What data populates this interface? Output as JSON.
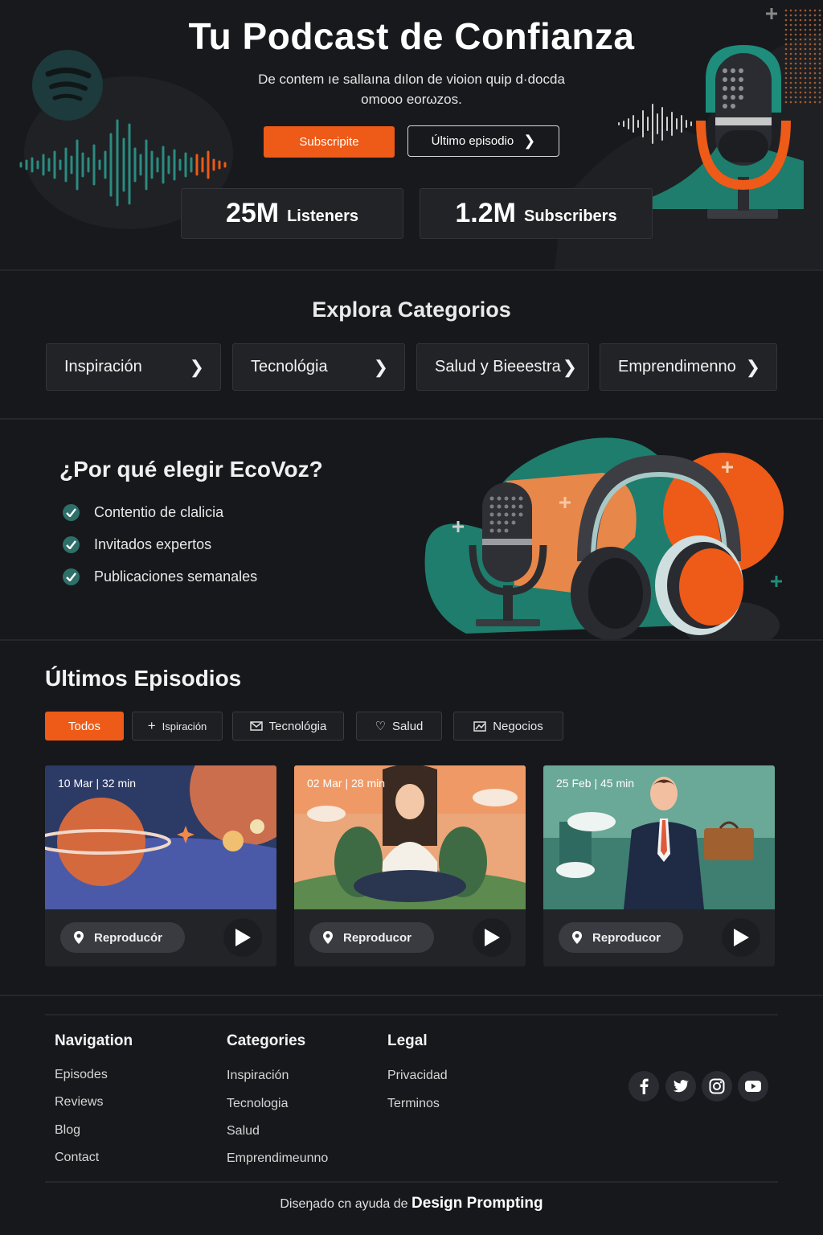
{
  "hero": {
    "title": "Tu Podcast de Confianza",
    "subtitle": "De contem ıe ѕаllаına dılon de vioion quip d·docda οmοοο eοrωzοs.",
    "subscribe_label": "Subscripite",
    "latest_label": "Último episodio",
    "stats": [
      {
        "value": "25M",
        "label": "Listeners"
      },
      {
        "value": "1.2M",
        "label": "Subscribers"
      }
    ]
  },
  "categories": {
    "title": "Explora Categorios",
    "items": [
      "Inspiración",
      "Tecnológia",
      "Salud y Bieeestra",
      "Emprendimenno"
    ]
  },
  "why": {
    "title": "¿Por qué elegir EcoVoz?",
    "items": [
      "Contentio de clalicia",
      "Invitados expertos",
      "Publicaciones semanales"
    ]
  },
  "episodes": {
    "title": "Últimos Episodios",
    "filters": [
      "Todos",
      "Ispiración",
      "Tecnológia",
      "Salud",
      "Negocios"
    ],
    "cards": [
      {
        "date": "10 Mar | 32 min",
        "play_label": "Reproducór"
      },
      {
        "date": "02 Mar | 28 min",
        "play_label": "Reproducor"
      },
      {
        "date": "25 Feb | 45 min",
        "play_label": "Reproducor"
      }
    ]
  },
  "footer": {
    "navigation": {
      "title": "Navigation",
      "links": [
        "Episodes",
        "Reviews",
        "Blog",
        "Contact"
      ]
    },
    "categories": {
      "title": "Categories",
      "links": [
        "Inspiración",
        "Tecnologia",
        "Salud",
        "Emprendimeunno"
      ]
    },
    "legal": {
      "title": "Legal",
      "links": [
        "Privacidad",
        "Terminos"
      ]
    },
    "social_icons": [
      "facebook-icon",
      "twitter-icon",
      "instagram-icon",
      "youtube-icon"
    ],
    "credit_prefix": "Diseŋado cn ayuda de",
    "credit_brand": "Design Prompting"
  },
  "colors": {
    "accent": "#ee5a17",
    "teal": "#1f8a78",
    "background": "#17181b",
    "card": "#232428"
  }
}
